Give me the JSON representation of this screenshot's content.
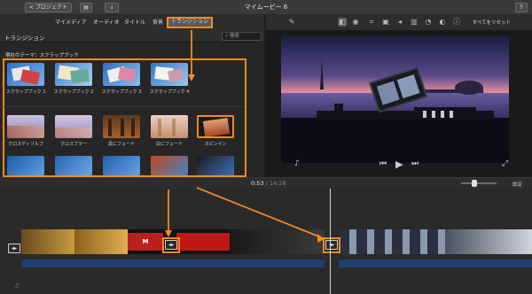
{
  "toolbar": {
    "back_label": "< プロジェクト",
    "title": "マイムービー 6"
  },
  "tabs": [
    {
      "label": "マイメディア"
    },
    {
      "label": "オーディオ"
    },
    {
      "label": "タイトル"
    },
    {
      "label": "背景"
    },
    {
      "label": "トランジション",
      "active": true
    }
  ],
  "browser": {
    "title": "トランジション",
    "search_placeholder": "検索",
    "section_label": "現在のテーマ：スクラップブック",
    "scrapbook_items": [
      {
        "label": "スクラップブック 1"
      },
      {
        "label": "スクラップブック 2"
      },
      {
        "label": "スクラップブック 3"
      },
      {
        "label": "スクラップブック 4"
      }
    ],
    "standard_items": [
      {
        "label": "クロスディゾルブ"
      },
      {
        "label": "クロスブラー"
      },
      {
        "label": "黒にフェード"
      },
      {
        "label": "白にフェード"
      },
      {
        "label": "スピンイン"
      }
    ]
  },
  "right_toolbar": {
    "reset_all_label": "すべてをリセット"
  },
  "timeline": {
    "current_time": "0:53",
    "separator": " / ",
    "total_time": "14:28",
    "settings_label": "設定"
  },
  "colors": {
    "accent_orange": "#f08a24",
    "audio_blue": "#2a5aa0"
  }
}
